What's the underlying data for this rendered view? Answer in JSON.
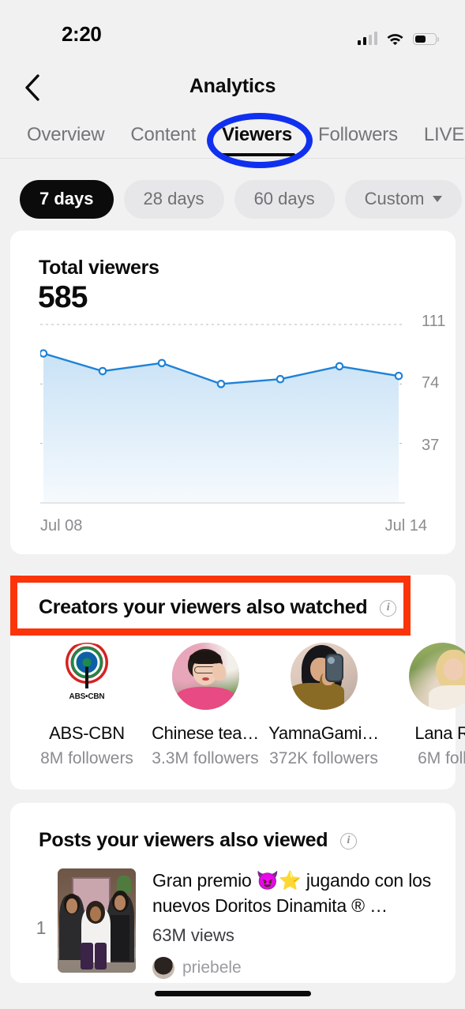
{
  "status_bar": {
    "time": "2:20",
    "icons": [
      "cellular-signal-icon",
      "wifi-icon",
      "battery-icon"
    ],
    "battery_percent": 56,
    "signal_bars_filled": 2,
    "signal_bars_total": 4
  },
  "nav": {
    "back_icon": "chevron-left-icon",
    "title": "Analytics"
  },
  "tabs": [
    {
      "label": "Overview",
      "active": false
    },
    {
      "label": "Content",
      "active": false
    },
    {
      "label": "Viewers",
      "active": true
    },
    {
      "label": "Followers",
      "active": false
    },
    {
      "label": "LIVE",
      "active": false
    }
  ],
  "date_filters": [
    {
      "label": "7 days",
      "active": true,
      "has_caret": false
    },
    {
      "label": "28 days",
      "active": false,
      "has_caret": false
    },
    {
      "label": "60 days",
      "active": false,
      "has_caret": false
    },
    {
      "label": "Custom",
      "active": false,
      "has_caret": true
    }
  ],
  "viewers_card": {
    "title": "Total viewers",
    "value": "585"
  },
  "chart_data": {
    "type": "area",
    "title": "Total viewers",
    "total": 585,
    "x": [
      "Jul 08",
      "Jul 09",
      "Jul 10",
      "Jul 11",
      "Jul 12",
      "Jul 13",
      "Jul 14"
    ],
    "values": [
      93,
      82,
      87,
      74,
      77,
      85,
      79
    ],
    "xtick_labels": [
      "Jul 08",
      "Jul 14"
    ],
    "ytick_labels": [
      "111",
      "74",
      "37"
    ],
    "ytick_values": [
      111,
      74,
      37
    ],
    "ylim": [
      0,
      111
    ],
    "grid": true,
    "legend": "none",
    "line_color": "#1f82d6",
    "fill_top_color": "#c9e2f6",
    "fill_bottom_color": "#f6fafd",
    "xlabel": "",
    "ylabel": ""
  },
  "creators_card": {
    "title": "Creators your viewers also watched",
    "info_icon": "info-icon",
    "creators": [
      {
        "name": "ABS-CBN",
        "followers": "8M followers",
        "avatar": "abs-cbn-logo",
        "wordmark": "ABS•CBN"
      },
      {
        "name": "Chinese tea…",
        "followers": "3.3M followers",
        "avatar": "creator-photo-a"
      },
      {
        "name": "YamnaGami…",
        "followers": "372K followers",
        "avatar": "creator-photo-b"
      },
      {
        "name": "Lana R",
        "followers": "6M foll",
        "avatar": "creator-photo-c"
      }
    ]
  },
  "posts_card": {
    "title": "Posts your viewers also viewed",
    "info_icon": "info-icon",
    "posts": [
      {
        "rank": "1",
        "caption": "Gran premio 😈⭐ jugando con los nuevos Doritos Dinamita ® …",
        "views": "63M views",
        "author": "priebele",
        "thumbnail": "post-thumbnail-kitchen"
      }
    ]
  },
  "annotations": [
    {
      "type": "ellipse",
      "target": "tab-viewers",
      "color": "#1030f0"
    },
    {
      "type": "rectangle",
      "target": "creators-title",
      "color": "#fb3409"
    }
  ],
  "home_indicator": "home-indicator"
}
